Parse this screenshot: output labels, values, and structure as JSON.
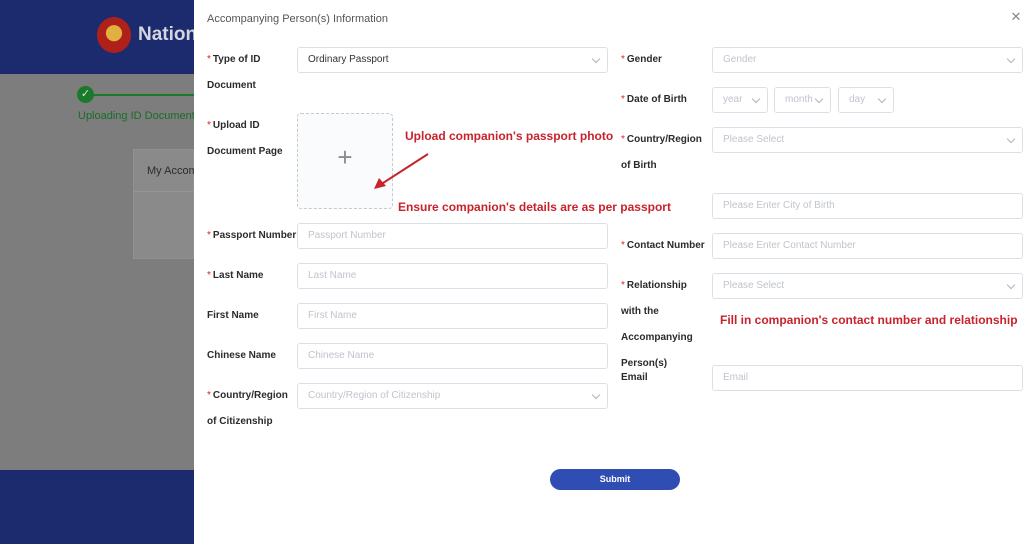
{
  "background": {
    "site_title": "Nation",
    "step_label": "Uploading ID Document I",
    "card_label": "My Accom",
    "colors": {
      "header": "#1c2a6e",
      "step": "#1a7a2c"
    }
  },
  "modal": {
    "title": "Accompanying Person(s) Information",
    "close_icon": "close-icon",
    "required_marker": "*",
    "left": {
      "id_type_label": "Type of ID Document",
      "id_type_value": "Ordinary Passport",
      "upload_label": "Upload ID Document Page",
      "upload_icon": "plus-icon",
      "passport_number_label": "Passport Number",
      "passport_number_placeholder": "Passport Number",
      "last_name_label": "Last Name",
      "last_name_placeholder": "Last Name",
      "first_name_label": "First Name",
      "first_name_placeholder": "First Name",
      "chinese_name_label": "Chinese Name",
      "chinese_name_placeholder": "Chinese Name",
      "citizenship_label": "Country/Region of Citizenship",
      "citizenship_placeholder": "Country/Region of Citizenship"
    },
    "right": {
      "gender_label": "Gender",
      "gender_placeholder": "Gender",
      "dob_label": "Date of Birth",
      "dob_year": "year",
      "dob_month": "month",
      "dob_day": "day",
      "birth_country_label": "Country/Region of Birth",
      "birth_country_placeholder": "Please Select",
      "birth_city_placeholder": "Please Enter City of Birth",
      "contact_label": "Contact Number",
      "contact_placeholder": "Please Enter Contact Number",
      "relationship_label": "Relationship with the Accompanying Person(s)",
      "relationship_placeholder": "Please Select",
      "email_label": "Email",
      "email_placeholder": "Email"
    },
    "submit_label": "Submit"
  },
  "annotations": {
    "upload_note": "Upload companion's passport photo",
    "details_note": "Ensure companion's details are as per passport",
    "contact_note": "Fill in companion's contact number and relationship",
    "color": "#c8232c"
  }
}
